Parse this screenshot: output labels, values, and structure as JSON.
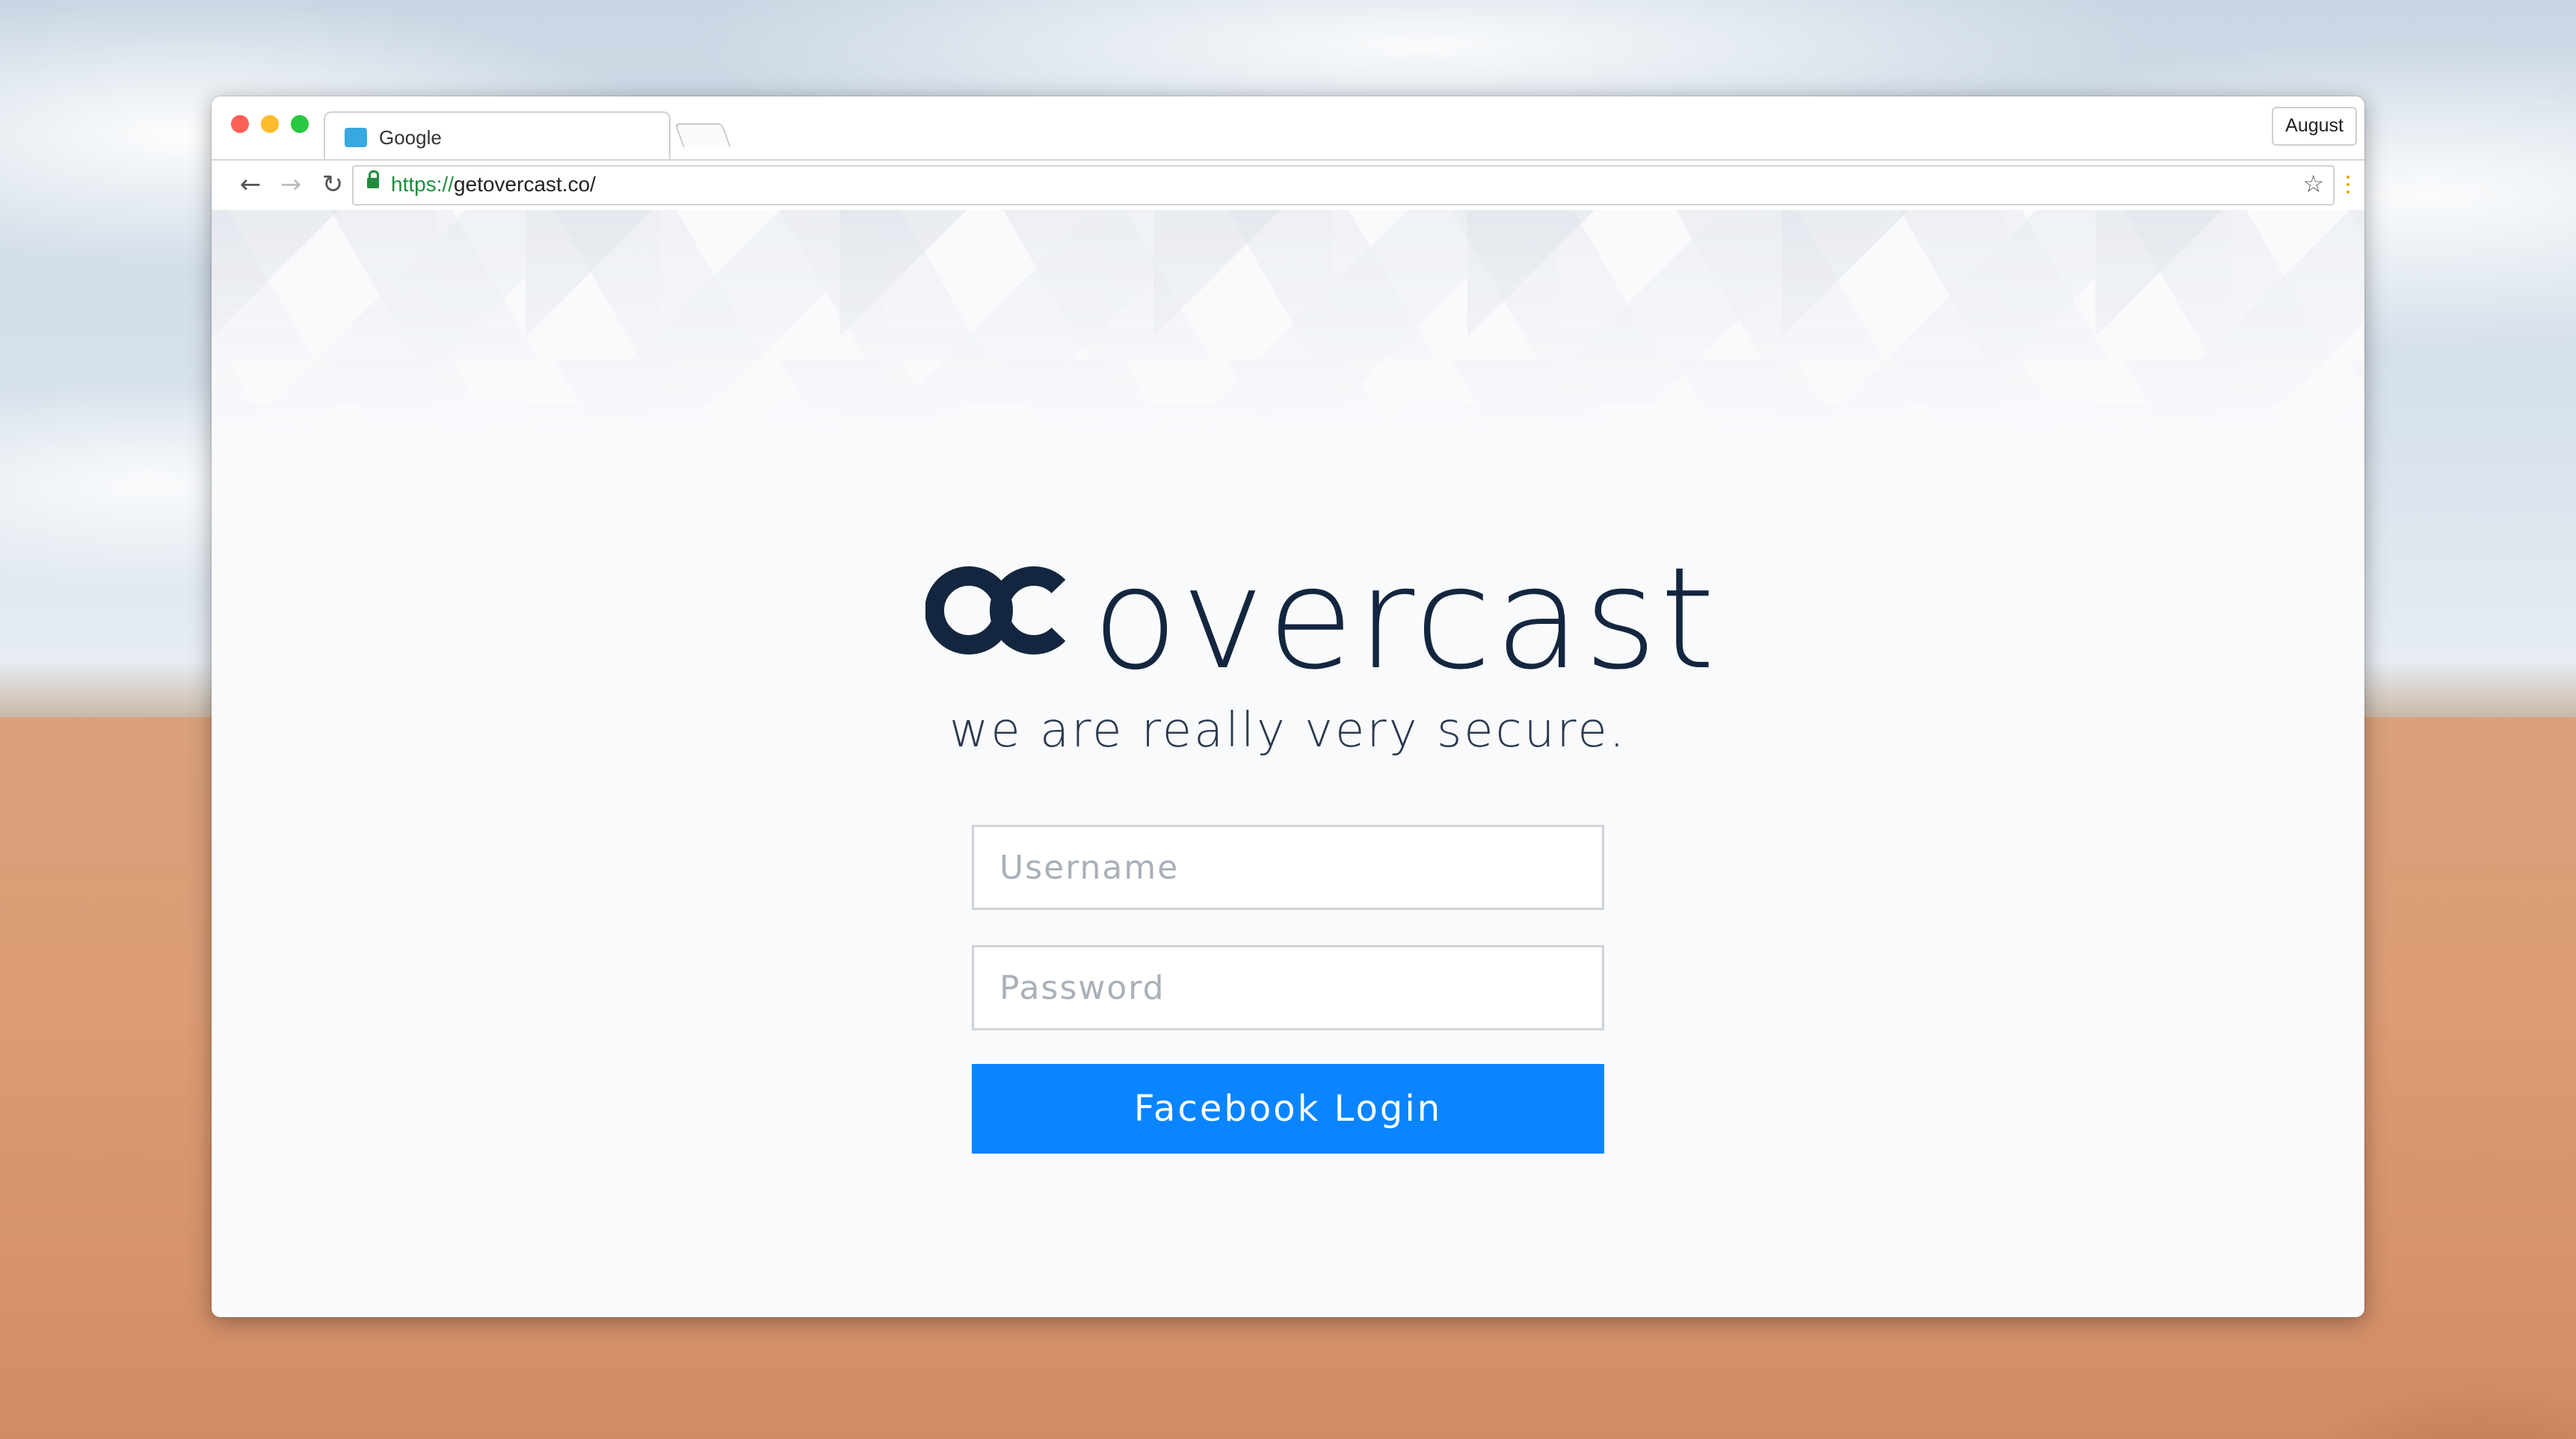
{
  "browser": {
    "tab_title": "Google",
    "profile_label": "August",
    "url_scheme": "https://",
    "url_rest": "getovercast.co/",
    "back_icon": "arrow-left-icon",
    "forward_icon": "arrow-right-icon",
    "reload_icon": "reload-icon",
    "lock_icon": "lock-icon",
    "star_icon": "star-icon",
    "menu_icon": "kebab-menu-icon"
  },
  "page": {
    "brand_name": "overcast",
    "brand_mark": "oc",
    "tagline": "we are really very secure.",
    "username_placeholder": "Username",
    "password_placeholder": "Password",
    "login_button": "Facebook Login",
    "brand_color": "#14263f",
    "button_color": "#0a84ff"
  }
}
